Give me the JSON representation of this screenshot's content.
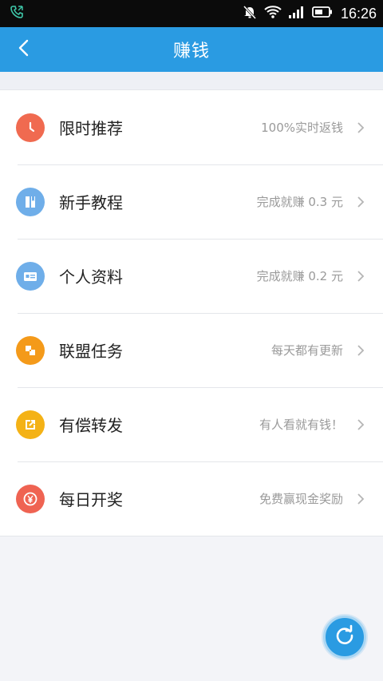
{
  "status_bar": {
    "time": "16:26"
  },
  "header": {
    "title": "赚钱"
  },
  "items": [
    {
      "label": "限时推荐",
      "hint": "100%实时返钱",
      "icon": "clock-icon",
      "color": "#f06a50"
    },
    {
      "label": "新手教程",
      "hint": "完成就赚 0.3 元",
      "icon": "book-icon",
      "color": "#6faee9"
    },
    {
      "label": "个人资料",
      "hint": "完成就赚 0.2 元",
      "icon": "profile-card-icon",
      "color": "#6faee9"
    },
    {
      "label": "联盟任务",
      "hint": "每天都有更新",
      "icon": "puzzle-icon",
      "color": "#f49a1a"
    },
    {
      "label": "有偿转发",
      "hint": "有人看就有钱！",
      "icon": "share-icon",
      "color": "#f4b216"
    },
    {
      "label": "每日开奖",
      "hint": "免费赢现金奖励",
      "icon": "yuan-coin-icon",
      "color": "#ef6352"
    }
  ],
  "colors": {
    "accent": "#2a9be2",
    "background": "#f3f4f8"
  }
}
